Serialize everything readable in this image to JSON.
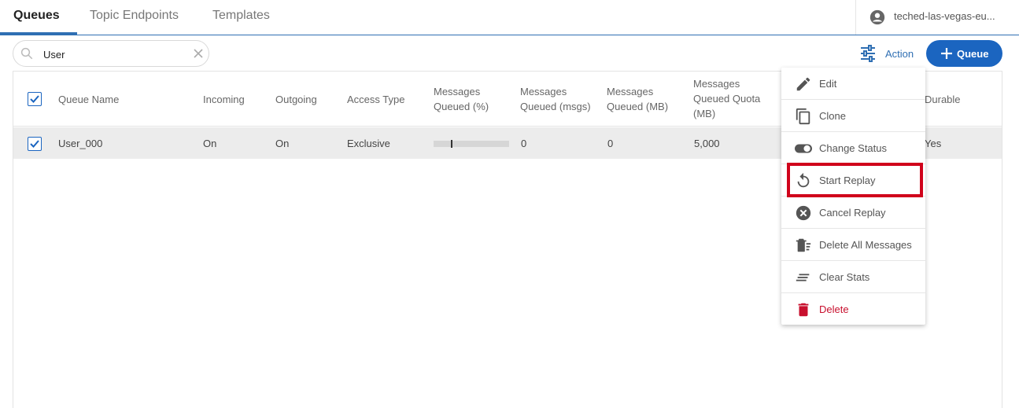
{
  "tabs": [
    {
      "label": "Queues",
      "active": true
    },
    {
      "label": "Topic Endpoints",
      "active": false
    },
    {
      "label": "Templates",
      "active": false
    }
  ],
  "user": {
    "name": "teched-las-vegas-eu...",
    "icon": "account-circle-icon"
  },
  "search": {
    "value": "User",
    "icon": "search-icon",
    "clear_icon": "close-icon"
  },
  "toolbar": {
    "action_label": "Action",
    "action_icon": "sliders-icon",
    "add_queue_label": "Queue",
    "add_icon": "plus-icon"
  },
  "table": {
    "columns": [
      "Queue Name",
      "Incoming",
      "Outgoing",
      "Access Type",
      "Messages Queued (%)",
      "Messages Queued (msgs)",
      "Messages Queued (MB)",
      "Messages Queued Quota (MB)",
      "Durable"
    ],
    "rows": [
      {
        "selected": true,
        "queue_name": "User_000",
        "incoming": "On",
        "outgoing": "On",
        "access_type": "Exclusive",
        "messages_queued_pct": 0,
        "messages_queued_msgs": "0",
        "messages_queued_mb": "0",
        "quota_mb": "5,000",
        "durable": "Yes"
      }
    ]
  },
  "menu": {
    "items": [
      {
        "label": "Edit",
        "icon": "pencil-icon"
      },
      {
        "label": "Clone",
        "icon": "copy-icon"
      },
      {
        "label": "Change Status",
        "icon": "toggle-icon"
      },
      {
        "label": "Start Replay",
        "icon": "replay-icon",
        "highlighted": true
      },
      {
        "label": "Cancel Replay",
        "icon": "cancel-circle-icon"
      },
      {
        "label": "Delete All Messages",
        "icon": "delete-list-icon"
      },
      {
        "label": "Clear Stats",
        "icon": "clear-lines-icon"
      },
      {
        "label": "Delete",
        "icon": "trash-icon",
        "danger": true
      }
    ]
  },
  "colors": {
    "accent": "#1b65c0",
    "danger": "#c8102e",
    "highlight_border": "#d0021b"
  }
}
